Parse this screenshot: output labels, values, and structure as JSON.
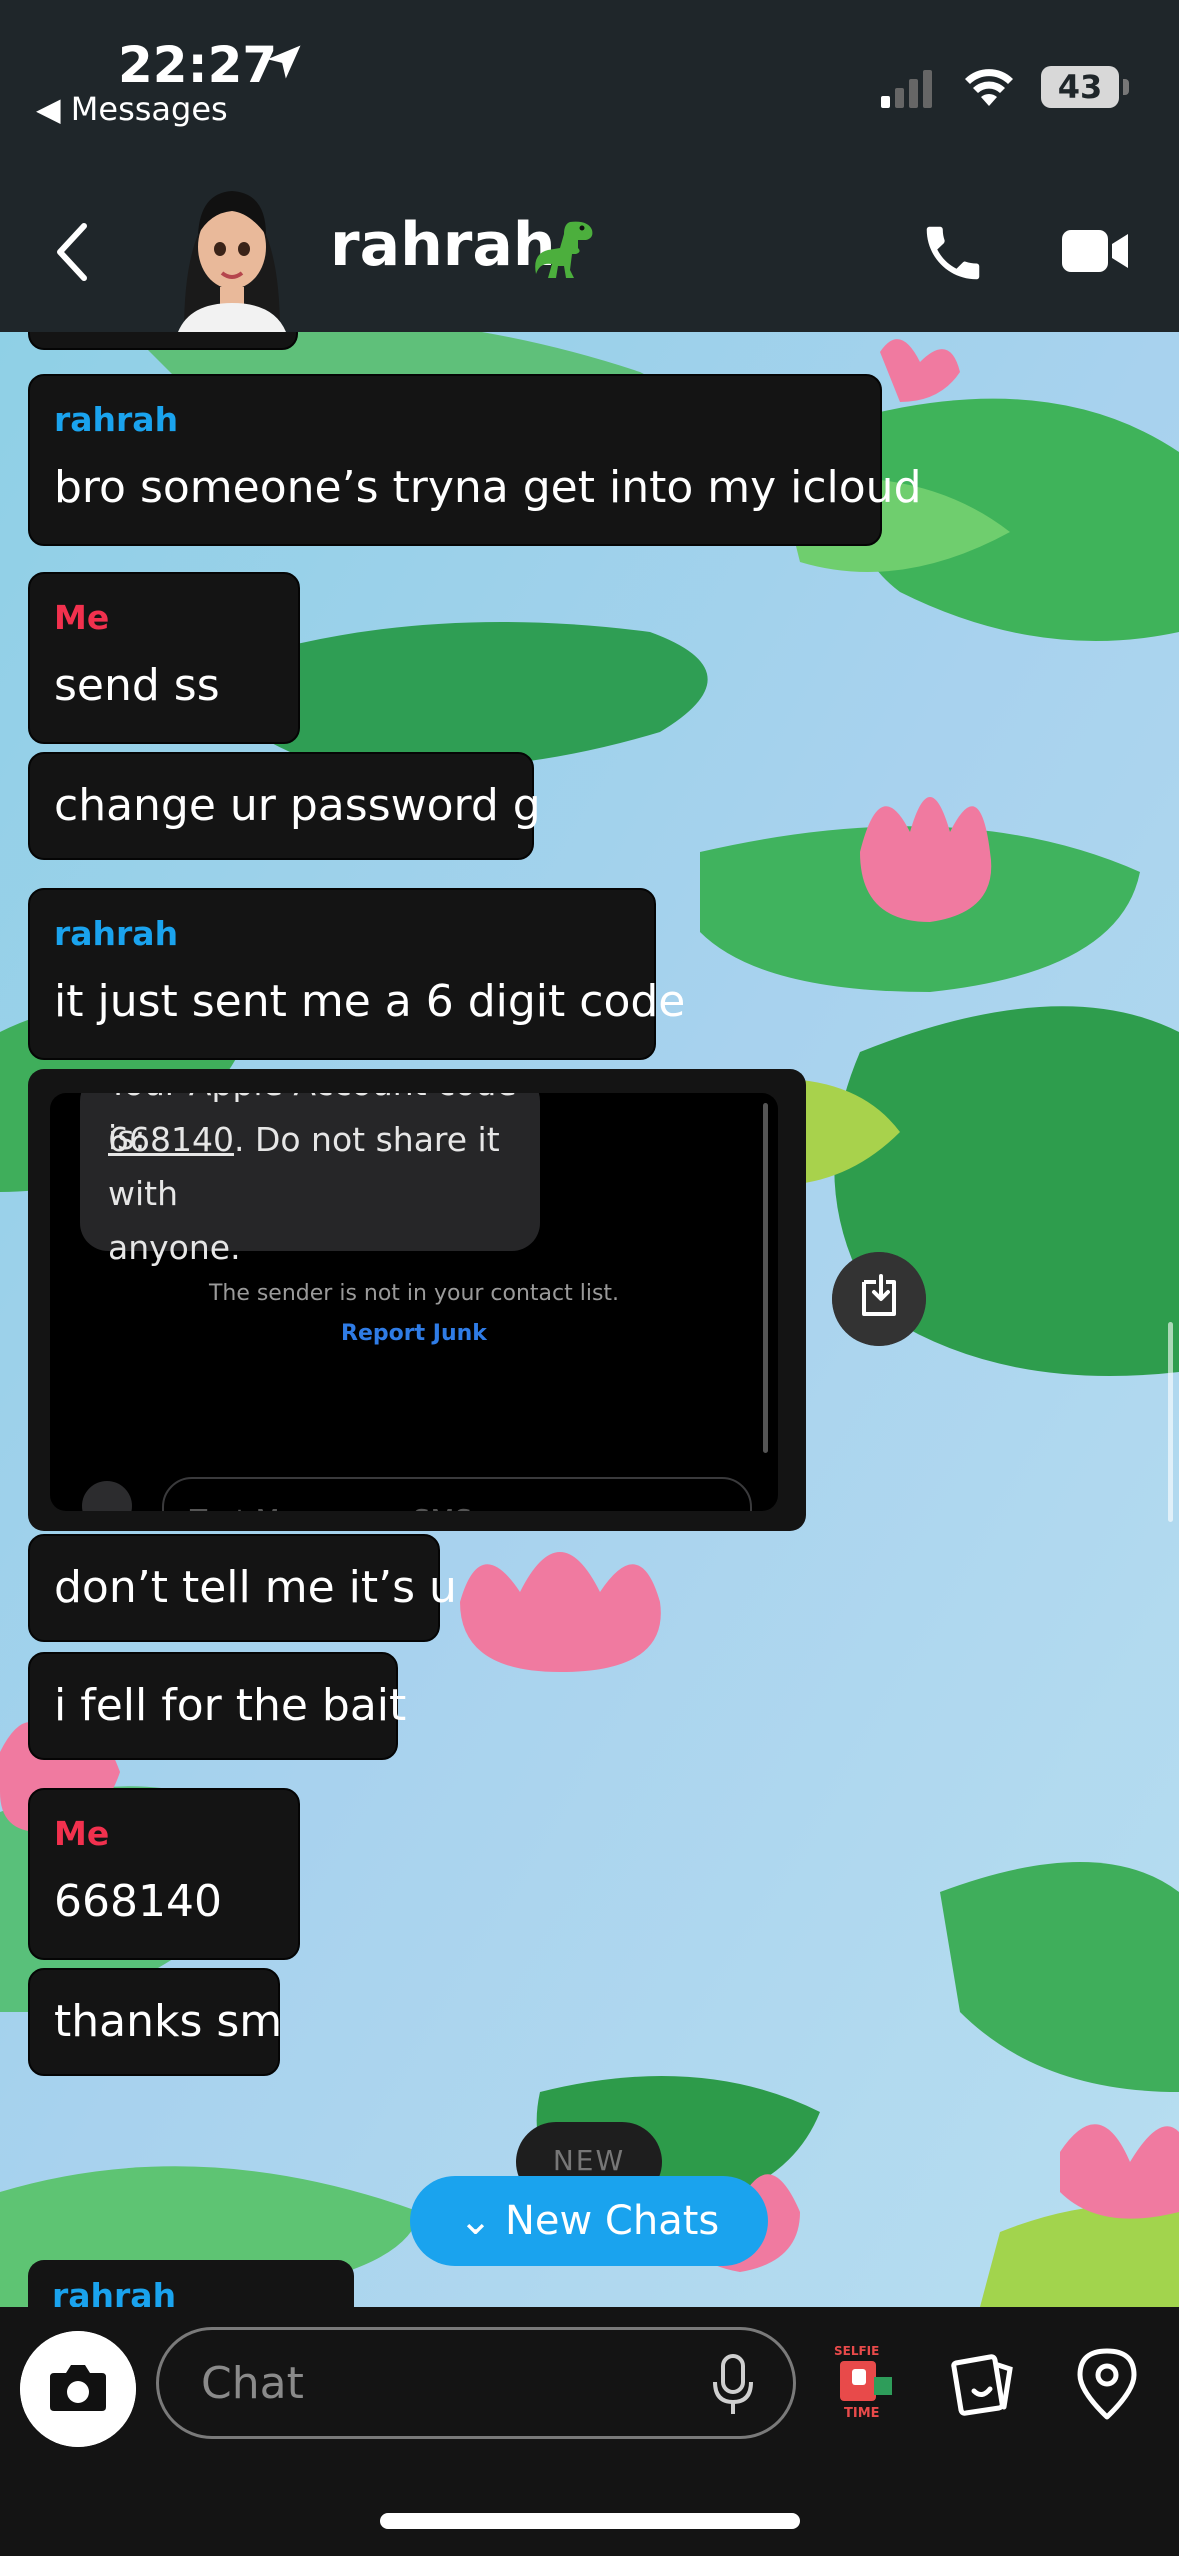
{
  "status_bar": {
    "time": "22:27",
    "back_app": "Messages",
    "battery": "43"
  },
  "header": {
    "title": "rahrah",
    "emoji_icon": "t-rex-icon"
  },
  "messages": [
    {
      "sender": "rahrah",
      "text": "bro someone’s tryna get into my icloud",
      "color": "#1aa3ee"
    },
    {
      "sender": "Me",
      "text": "send ss",
      "color": "#f2314e"
    },
    {
      "text": "change ur password g"
    },
    {
      "sender": "rahrah",
      "text": "it just sent me a 6 digit code",
      "color": "#1aa3ee"
    },
    {
      "text": "don’t tell me it’s u"
    },
    {
      "text": "i fell for the bait"
    },
    {
      "sender": "Me",
      "text": "668140",
      "color": "#f2314e"
    },
    {
      "text": "thanks sm"
    }
  ],
  "snap_image": {
    "line0": "Your Apple Account code is:",
    "code": "668140",
    "line1_rest": ". Do not share it with",
    "line2": "anyone.",
    "sender_note": "The sender is not in your contact list.",
    "report_link": "Report Junk",
    "input_placeholder": "Text Message • SMS"
  },
  "new_pill": "NEW",
  "new_chats_button": "⌄ New Chats",
  "peek_sender": "rahrah",
  "composer": {
    "placeholder": "Chat",
    "selfie_sticker_text": "SELFIE TIME"
  }
}
